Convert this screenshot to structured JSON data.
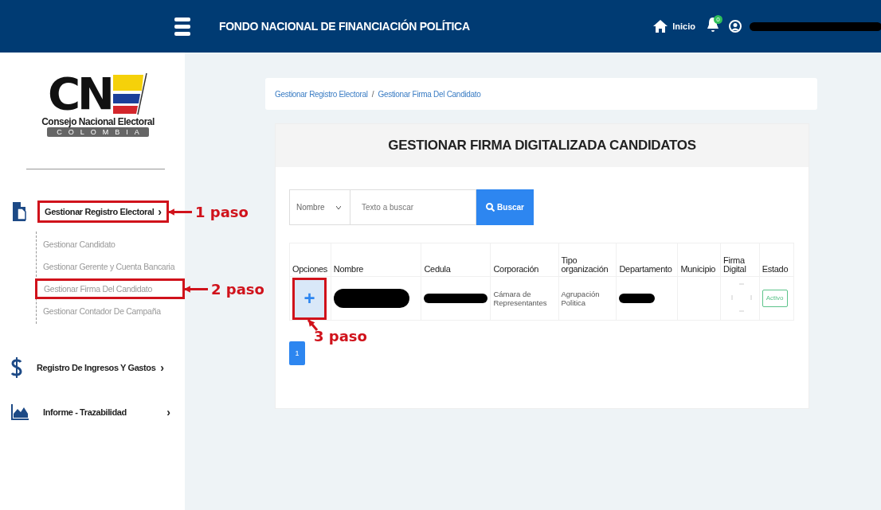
{
  "header": {
    "title": "FONDO NACIONAL DE FINANCIACIÓN POLÍTICA",
    "home_label": "Inicio",
    "notification_count": "0"
  },
  "logo": {
    "letters": "CN",
    "name": "Consejo Nacional Electoral",
    "country": "COLOMBIA"
  },
  "sidebar": {
    "items": [
      {
        "kind": "document",
        "label": "Gestionar Registro Electoral",
        "chevron": "›",
        "annotation": "1 paso",
        "children": [
          {
            "label": "Gestionar Candidato"
          },
          {
            "label": "Gestionar Gerente y Cuenta Bancaria"
          },
          {
            "label": "Gestionar Firma Del Candidato",
            "annotation": "2 paso"
          },
          {
            "label": "Gestionar Contador De Campaña"
          }
        ]
      },
      {
        "kind": "dollar",
        "label": "Registro De Ingresos Y Gastos",
        "chevron": "›"
      },
      {
        "kind": "chart",
        "label": "Informe - Trazabilidad",
        "chevron": "›"
      }
    ]
  },
  "breadcrumb": {
    "items": [
      "Gestionar Registro Electoral",
      "Gestionar Firma Del Candidato"
    ],
    "separator": "/"
  },
  "panel": {
    "title": "GESTIONAR FIRMA DIGITALIZADA CANDIDATOS",
    "search": {
      "field": "Nombre",
      "placeholder": "Texto a buscar",
      "button": "Buscar"
    },
    "table": {
      "columns": [
        "Opciones",
        "Nombre",
        "Cedula",
        "Corporación",
        "Tipo organización",
        "Departamento",
        "Municipio",
        "Firma Digital",
        "Estado"
      ],
      "rows": [
        {
          "cells": [
            {
              "kind": "add_button",
              "text": "+",
              "annotation": "3 paso"
            },
            {
              "kind": "redacted"
            },
            {
              "kind": "redacted"
            },
            {
              "kind": "text",
              "text": "Cámara de Representantes"
            },
            {
              "kind": "text",
              "text": "Agrupación Politica"
            },
            {
              "kind": "redacted"
            },
            {
              "kind": "empty"
            },
            {
              "kind": "signature"
            },
            {
              "kind": "status",
              "text": "Activo"
            }
          ]
        }
      ]
    },
    "pagination": [
      {
        "label": "1",
        "selected": true
      }
    ]
  }
}
